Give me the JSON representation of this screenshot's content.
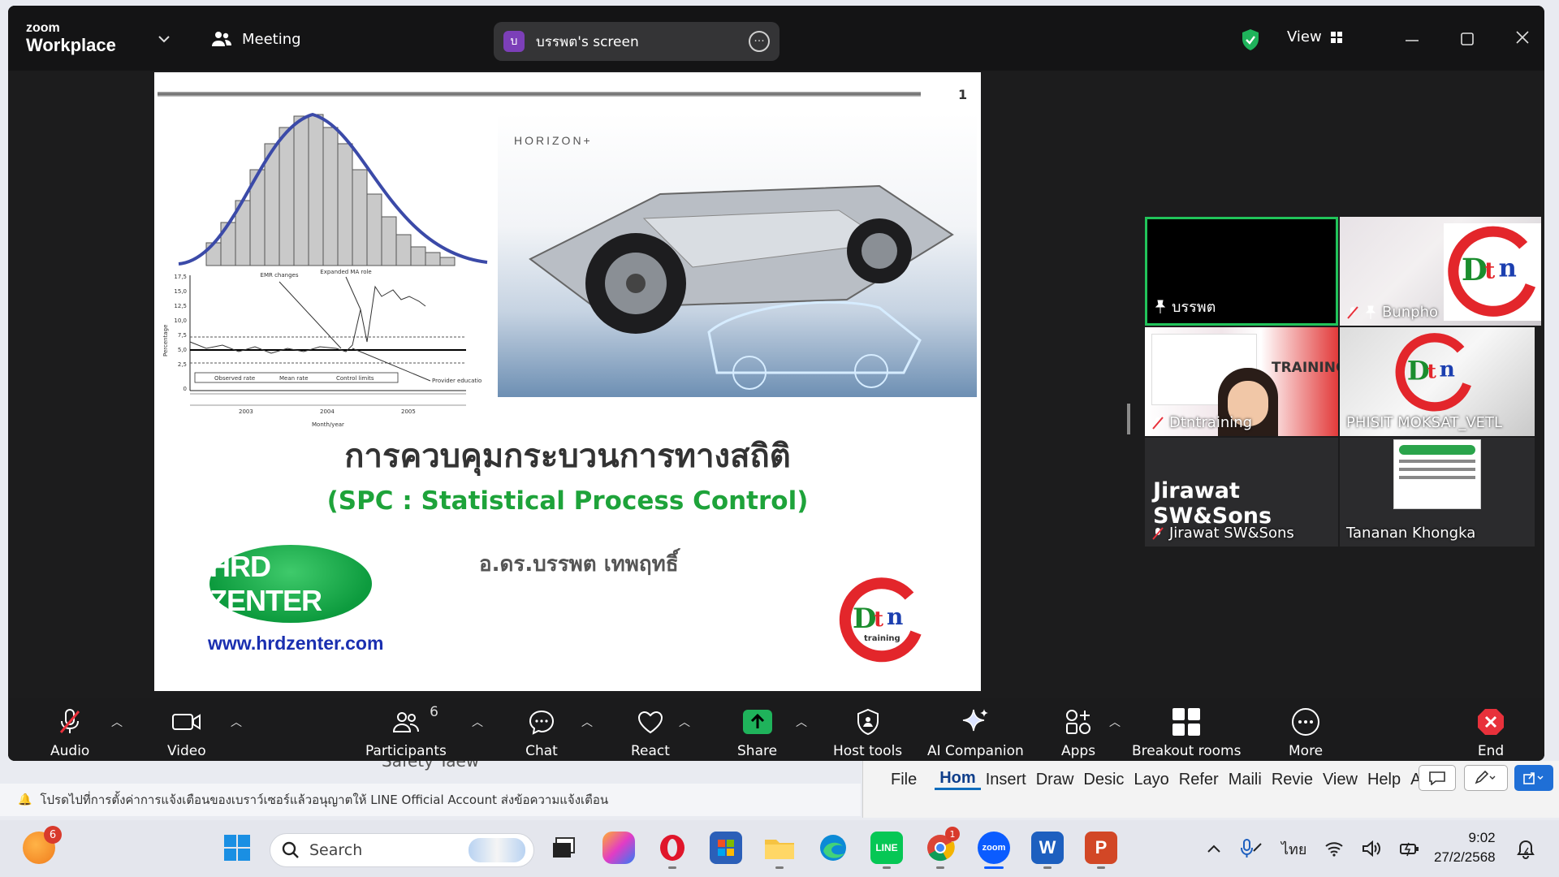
{
  "background": {
    "notice_text": "โปรดไปที่การตั้งค่าการแจ้งเตือนของเบราว์เซอร์แล้วอนุญาตให้ LINE Official Account ส่งข้อความแจ้งเตือน",
    "behind_text": "Safety Taew",
    "word_tabs": [
      "File",
      "Hom",
      "Insert",
      "Draw",
      "Desic",
      "Layo",
      "Refer",
      "Maili",
      "Revie",
      "View",
      "Help",
      "Acrol"
    ]
  },
  "titlebar": {
    "logo_line1": "zoom",
    "logo_line2": "Workplace",
    "meeting_label": "Meeting",
    "share_avatar": "บ",
    "share_label": "บรรพต's screen",
    "view_label": "View"
  },
  "slide": {
    "page_number": "1",
    "horizon_label": "HORIZON+",
    "title": "การควบคุมกระบวนการทางสถิติ",
    "subtitle": "(SPC : Statistical Process Control)",
    "author": "อ.ดร.บรรพต  เทพฤทธิ์",
    "hrd_logo": "HRD ZENTER",
    "url": "www.hrdzenter.com",
    "control_chart": {
      "ylabel": "Percentage",
      "xlabel": "Month/year",
      "y_ticks": [
        "17,5",
        "15,0",
        "12,5",
        "10,0",
        "7,5",
        "5,0",
        "2,5",
        "0"
      ],
      "annotations": [
        "EMR changes",
        "Expanded MA role",
        "Provider education"
      ],
      "legend": [
        "Observed rate",
        "Mean rate",
        "Control limits"
      ],
      "years": [
        "2003",
        "2004",
        "2005"
      ]
    }
  },
  "gallery": {
    "tiles": [
      {
        "name": "บรรพต"
      },
      {
        "name": "Bunpho"
      },
      {
        "name": "Dtntraining"
      },
      {
        "name": "PHISIT MOKSAT_VETL"
      },
      {
        "name": "Jirawat SW&Sons",
        "big_name": "Jirawat SW&Sons"
      },
      {
        "name": "Tananan  Khongka"
      }
    ],
    "training_label": "TRAINING",
    "dtn_logo_text": "training"
  },
  "toolbar": {
    "audio": "Audio",
    "video": "Video",
    "participants": "Participants",
    "participants_count": "6",
    "chat": "Chat",
    "react": "React",
    "share": "Share",
    "host_tools": "Host tools",
    "ai_companion": "AI Companion",
    "apps": "Apps",
    "breakout_rooms": "Breakout rooms",
    "more": "More",
    "end": "End"
  },
  "taskbar": {
    "search_placeholder": "Search",
    "weather_badge": "6",
    "chrome_badge": "1",
    "lang": "ไทย",
    "time": "9:02",
    "date": "27/2/2568"
  },
  "colors": {
    "zoom_green": "#12a24b",
    "share_green": "#1fb35b",
    "end_red": "#e8313b",
    "slide_green": "#1ea33a",
    "url_blue": "#1a2fb0"
  }
}
